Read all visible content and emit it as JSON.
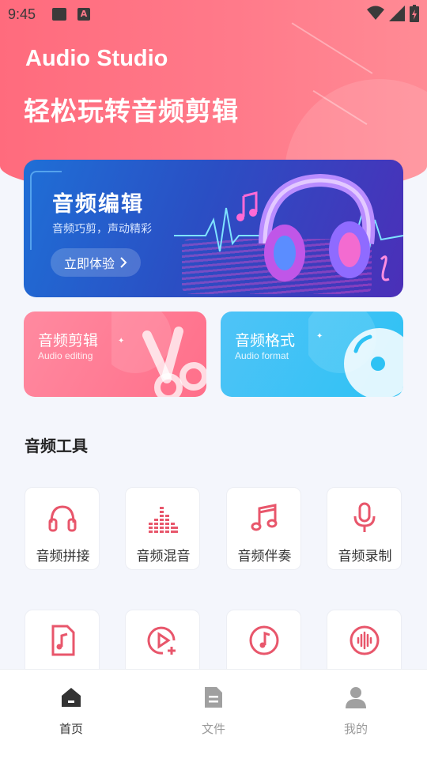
{
  "status_bar": {
    "time": "9:45"
  },
  "header": {
    "app_title": "Audio Studio",
    "slogan": "轻松玩转音频剪辑"
  },
  "banner": {
    "title": "音频编辑",
    "subtitle": "音频巧剪，声动精彩",
    "button_label": "立即体验"
  },
  "cards": [
    {
      "title": "音频剪辑",
      "subtitle": "Audio editing"
    },
    {
      "title": "音频格式",
      "subtitle": "Audio format"
    }
  ],
  "tools_section": {
    "title": "音频工具",
    "items": [
      {
        "label": "音频拼接",
        "icon": "headphones-icon"
      },
      {
        "label": "音频混音",
        "icon": "equalizer-icon"
      },
      {
        "label": "音频伴奏",
        "icon": "music-note-icon"
      },
      {
        "label": "音频录制",
        "icon": "microphone-icon"
      },
      {
        "label": "",
        "icon": "audio-file-icon"
      },
      {
        "label": "",
        "icon": "video-add-icon"
      },
      {
        "label": "",
        "icon": "music-disc-icon"
      },
      {
        "label": "",
        "icon": "sound-wave-icon"
      }
    ]
  },
  "bottom_nav": {
    "items": [
      {
        "label": "首页",
        "icon": "home-icon",
        "active": true
      },
      {
        "label": "文件",
        "icon": "file-icon",
        "active": false
      },
      {
        "label": "我的",
        "icon": "user-icon",
        "active": false
      }
    ]
  },
  "colors": {
    "accent": "#e8566b",
    "header": "#ff7a8a",
    "nav_active": "#333333",
    "nav_inactive": "#9a9a9a"
  }
}
